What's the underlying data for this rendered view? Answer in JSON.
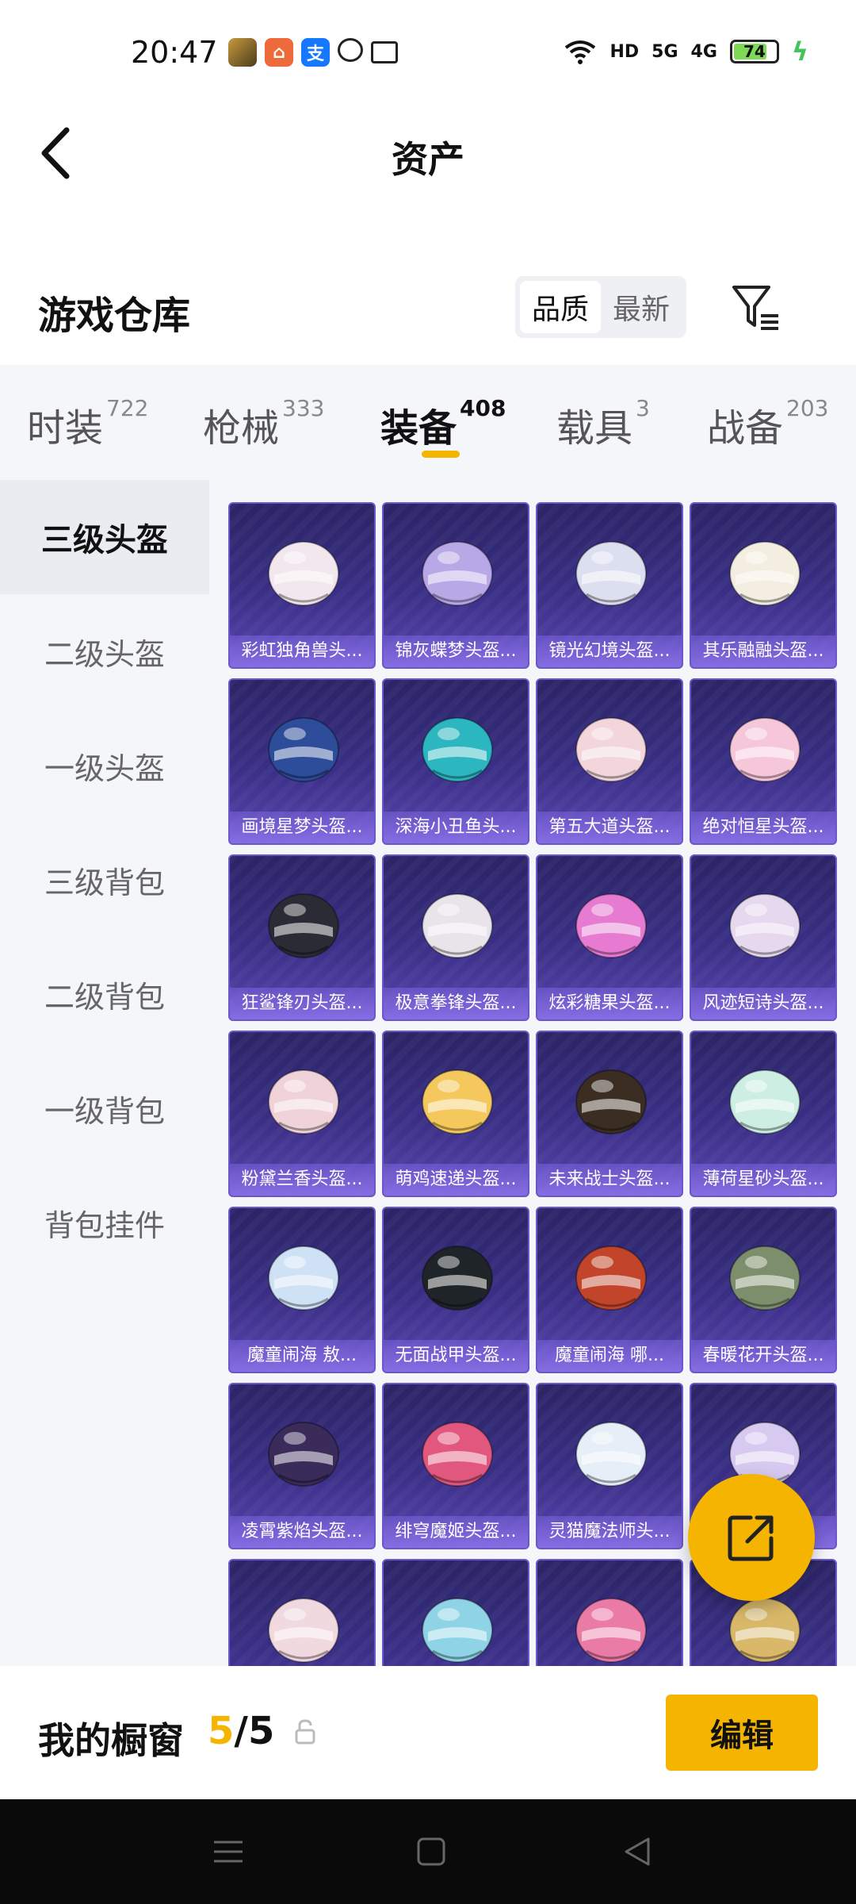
{
  "status_bar": {
    "time": "20:47",
    "notification_icons": [
      "game-app-icon",
      "app-icon",
      "alipay-icon",
      "chat-icon",
      "message-icon"
    ],
    "hd_label": "HD",
    "sim1": "5G",
    "sim2": "4G",
    "battery": "74",
    "battery_level": 0.74
  },
  "nav": {
    "title": "资产"
  },
  "warehouse": {
    "title": "游戏仓库",
    "sort_options": [
      "品质",
      "最新"
    ],
    "active_sort": "品质"
  },
  "categories": [
    {
      "label": "时装",
      "count": "722"
    },
    {
      "label": "枪械",
      "count": "333"
    },
    {
      "label": "装备",
      "count": "408"
    },
    {
      "label": "载具",
      "count": "3"
    },
    {
      "label": "战备",
      "count": "203"
    }
  ],
  "active_category": "装备",
  "side_menu": [
    {
      "label": "三级头盔"
    },
    {
      "label": "二级头盔"
    },
    {
      "label": "一级头盔"
    },
    {
      "label": "三级背包"
    },
    {
      "label": "二级背包"
    },
    {
      "label": "一级背包"
    },
    {
      "label": "背包挂件"
    }
  ],
  "items": [
    {
      "name": "彩虹独角兽头...",
      "color": "#f3e7ee"
    },
    {
      "name": "锦灰蝶梦头盔...",
      "color": "#b9a8e6"
    },
    {
      "name": "镜光幻境头盔...",
      "color": "#dcdff0"
    },
    {
      "name": "其乐融融头盔...",
      "color": "#f4eee0"
    },
    {
      "name": "画境星梦头盔...",
      "color": "#2d4c9a"
    },
    {
      "name": "深海小丑鱼头...",
      "color": "#2bb6c0"
    },
    {
      "name": "第五大道头盔...",
      "color": "#f2d6db"
    },
    {
      "name": "绝对恒星头盔...",
      "color": "#f6c6d9"
    },
    {
      "name": "狂鲨锋刃头盔...",
      "color": "#2a2b34"
    },
    {
      "name": "极意拳锋头盔...",
      "color": "#e9e3ea"
    },
    {
      "name": "炫彩糖果头盔...",
      "color": "#e77bd2"
    },
    {
      "name": "风迹短诗头盔...",
      "color": "#e6d8ee"
    },
    {
      "name": "粉黛兰香头盔...",
      "color": "#f0d3d8"
    },
    {
      "name": "萌鸡速递头盔...",
      "color": "#f5c85d"
    },
    {
      "name": "未来战士头盔...",
      "color": "#3b2d22"
    },
    {
      "name": "薄荷星砂头盔...",
      "color": "#cdeee2"
    },
    {
      "name": "魔童闹海 敖...",
      "color": "#cfe1f5"
    },
    {
      "name": "无面战甲头盔...",
      "color": "#1f2428"
    },
    {
      "name": "魔童闹海 哪...",
      "color": "#c2452b"
    },
    {
      "name": "春暖花开头盔...",
      "color": "#7c8e6c"
    },
    {
      "name": "凌霄紫焰头盔...",
      "color": "#3a2b5a"
    },
    {
      "name": "绯穹魔姬头盔...",
      "color": "#e2577e"
    },
    {
      "name": "灵猫魔法师头...",
      "color": "#e6eef8"
    },
    {
      "name": "...",
      "color": "#d7c9f0"
    },
    {
      "name": "",
      "color": "#f1d9e0"
    },
    {
      "name": "",
      "color": "#8fd4e6"
    },
    {
      "name": "",
      "color": "#ea7aa6"
    },
    {
      "name": "",
      "color": "#d9b86a"
    }
  ],
  "showcase": {
    "label": "我的橱窗",
    "used": "5",
    "separator": "/",
    "total": "5",
    "edit_label": "编辑"
  },
  "colors": {
    "accent": "#f5b400",
    "card_bg": "#3a2f86",
    "page_bg": "#f4f6fa"
  }
}
